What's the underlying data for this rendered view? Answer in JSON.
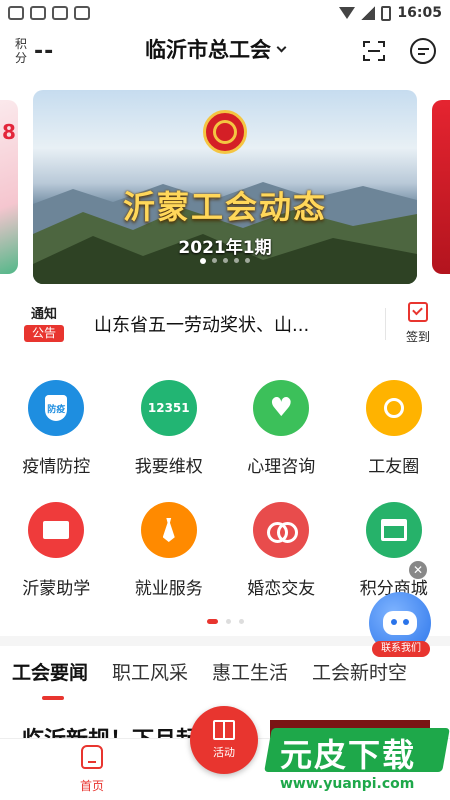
{
  "status_bar": {
    "time": "16:05"
  },
  "header": {
    "points_label": "积分",
    "points_value": "--",
    "city": "临沂市总工会"
  },
  "banner": {
    "left_peek_text": "8",
    "title": "沂蒙工会动态",
    "subtitle": "2021年1期",
    "dot_count": 5,
    "active_dot": 0
  },
  "notice": {
    "badge_top": "通知",
    "badge_bottom": "公告",
    "text": "山东省五一劳动奖状、山...",
    "checkin_label": "签到"
  },
  "grid": [
    {
      "label": "疫情防控",
      "icon": "epidemic-shield-icon",
      "icon_text": "防疫",
      "color": "#1e8ee0"
    },
    {
      "label": "我要维权",
      "icon": "hotline-12351-icon",
      "icon_text": "12351",
      "color": "#22b573"
    },
    {
      "label": "心理咨询",
      "icon": "heart-pulse-icon",
      "icon_text": "",
      "color": "#3cc05a"
    },
    {
      "label": "工友圈",
      "icon": "circle-icon",
      "icon_text": "",
      "color": "#ffb300"
    },
    {
      "label": "沂蒙助学",
      "icon": "book-hand-icon",
      "icon_text": "",
      "color": "#ef3b3b"
    },
    {
      "label": "就业服务",
      "icon": "tie-icon",
      "icon_text": "",
      "color": "#ff8a00"
    },
    {
      "label": "婚恋交友",
      "icon": "rings-icon",
      "icon_text": "",
      "color": "#e84c4c"
    },
    {
      "label": "积分商城",
      "icon": "shop-icon",
      "icon_text": "",
      "color": "#26b26a"
    }
  ],
  "contact": {
    "label": "联系我们",
    "close": "✕"
  },
  "tabs": [
    {
      "label": "工会要闻",
      "active": true
    },
    {
      "label": "职工风采",
      "active": false
    },
    {
      "label": "惠工生活",
      "active": false
    },
    {
      "label": "工会新时空",
      "active": false
    }
  ],
  "news": {
    "title": "临沂新规！下月起 样"
  },
  "bottom_nav": {
    "home_label": "首页",
    "activity_label": "活动"
  },
  "watermark": {
    "text": "元皮下载",
    "url": "www.yuanpi.com"
  },
  "colors": {
    "accent": "#e8352f"
  }
}
